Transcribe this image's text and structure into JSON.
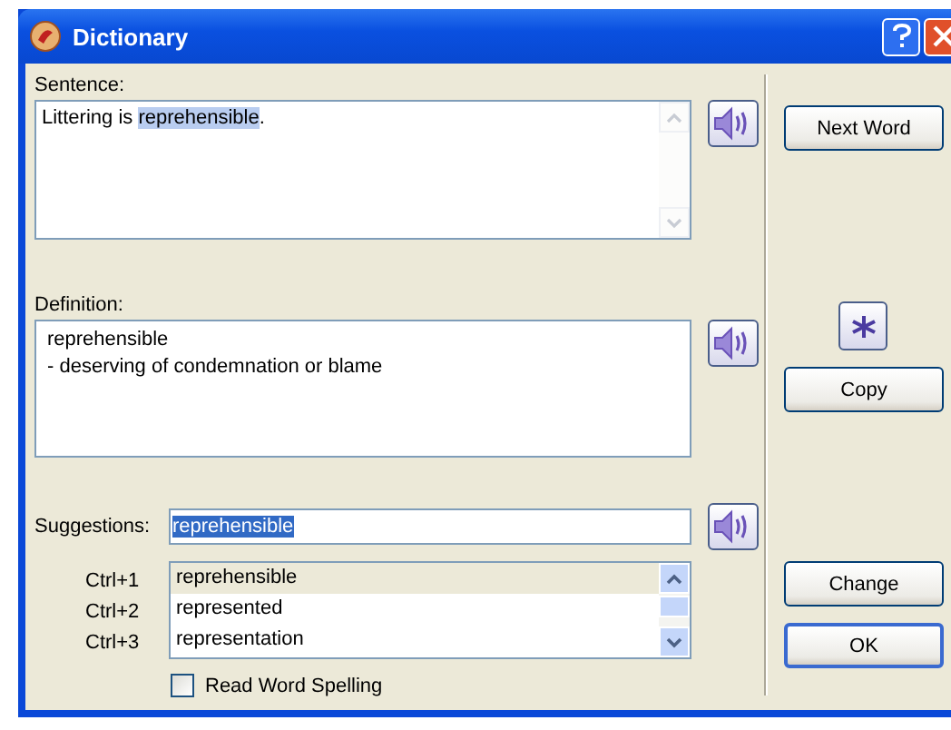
{
  "window": {
    "title": "Dictionary"
  },
  "sentence": {
    "label": "Sentence:",
    "segments": [
      {
        "text": "Littering is ",
        "highlighted": false
      },
      {
        "text": "reprehensible",
        "highlighted": true
      },
      {
        "text": ".",
        "highlighted": false
      }
    ]
  },
  "definition": {
    "label": "Definition:",
    "lines": [
      "reprehensible",
      "- deserving of condemnation or blame"
    ]
  },
  "suggestions": {
    "label": "Suggestions:",
    "value": "reprehensible",
    "value_selected": true,
    "items": [
      {
        "shortcut": "Ctrl+1",
        "word": "reprehensible",
        "selected": true
      },
      {
        "shortcut": "Ctrl+2",
        "word": "represented",
        "selected": false
      },
      {
        "shortcut": "Ctrl+3",
        "word": "representation",
        "selected": false
      }
    ]
  },
  "read_spelling": {
    "label": "Read Word Spelling",
    "checked": false
  },
  "buttons": {
    "next_word": "Next Word",
    "copy": "Copy",
    "change": "Change",
    "ok": "OK"
  }
}
